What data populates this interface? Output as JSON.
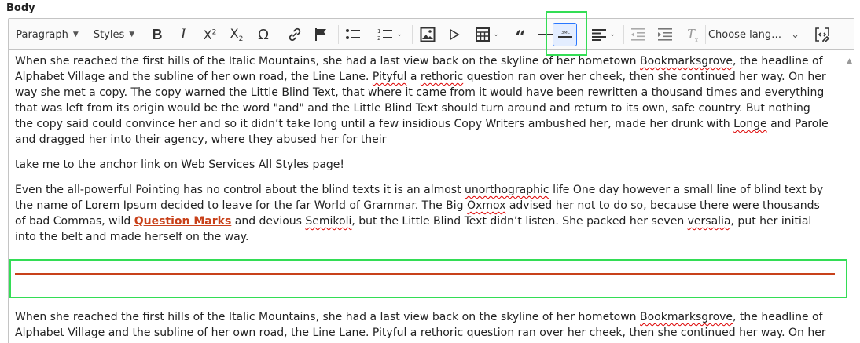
{
  "field": {
    "label": "Body"
  },
  "toolbar": {
    "heading_dropdown": "Paragraph",
    "styles_dropdown": "Styles",
    "language_dropdown": "Choose lang…",
    "colors": {
      "accent": "#2977ff",
      "highlight": "#33dd55",
      "link": "#c8411a",
      "hr": "#c8411a"
    },
    "icons": [
      "bold-icon",
      "italic-icon",
      "superscript-icon",
      "subscript-icon",
      "special-characters-icon",
      "link-icon",
      "anchor-flag-icon",
      "bulleted-list-icon",
      "numbered-list-icon",
      "image-icon",
      "media-embed-icon",
      "table-icon",
      "block-quote-icon",
      "horizontal-line-icon",
      "horizontal-rule-style-icon",
      "alignment-icon",
      "outdent-icon",
      "indent-icon",
      "remove-format-icon",
      "source-editing-icon"
    ]
  },
  "content": {
    "p1": "When she reached the first hills of the Italic Mountains, she had a last view back on the skyline of her hometown",
    "p1_w_bookmarksgrove": "Bookmarksgrove",
    "p1_b": ", the headline of Alphabet Village and the subline of her own road, the Line Lane.",
    "p1_w_pityful": "Pityful",
    "p1_w_a": "a",
    "p1_w_rethoric": "rethoric",
    "p1_c": "question ran over her cheek, then she continued her way. On her way she met a copy. The copy warned the Little Blind Text, that where it came from it would have been rewritten a thousand times and everything that was left from its origin would be the word \"and\" and the Little Blind Text should turn around and return to its own, safe country. But nothing the copy said could convince her and so it didn’t take long until a few insidious Copy Writers ambushed her, made her drunk with",
    "p1_w_longe": "Longe",
    "p1_d": "and Parole and dragged her into their agency, where they abused her for their",
    "p2": "take me to the anchor link on Web Services All Styles page!",
    "p3_a": "Even the all-powerful Pointing has no control about the blind texts it is an almost",
    "p3_w_unorthographic": "unorthographic",
    "p3_b": "life One day however a small line of blind text by the name of Lorem Ipsum decided to leave for the far World of Grammar. The Big",
    "p3_w_oxmox": "Oxmox",
    "p3_c": "advised her not to do so, because there were thousands of bad Commas, wild",
    "p3_link": "Question Marks",
    "p3_d": "and devious",
    "p3_w_semikoli": "Semikoli",
    "p3_e": ", but the Little Blind Text didn’t listen. She packed her seven",
    "p3_w_versalia": "versalia",
    "p3_f": ", put her initial into the belt and made herself on the way.",
    "p4_a": "When she reached the first hills of the Italic Mountains, she had a last view back on the skyline of her hometown",
    "p4_w_bookmarksgrove": "Bookmarksgrove",
    "p4_b": ", the headline of Alphabet Village and the subline of her own road, the Line Lane. Pityful a rethoric question ran over her cheek, then she continued her way. On her way she met a copy."
  }
}
